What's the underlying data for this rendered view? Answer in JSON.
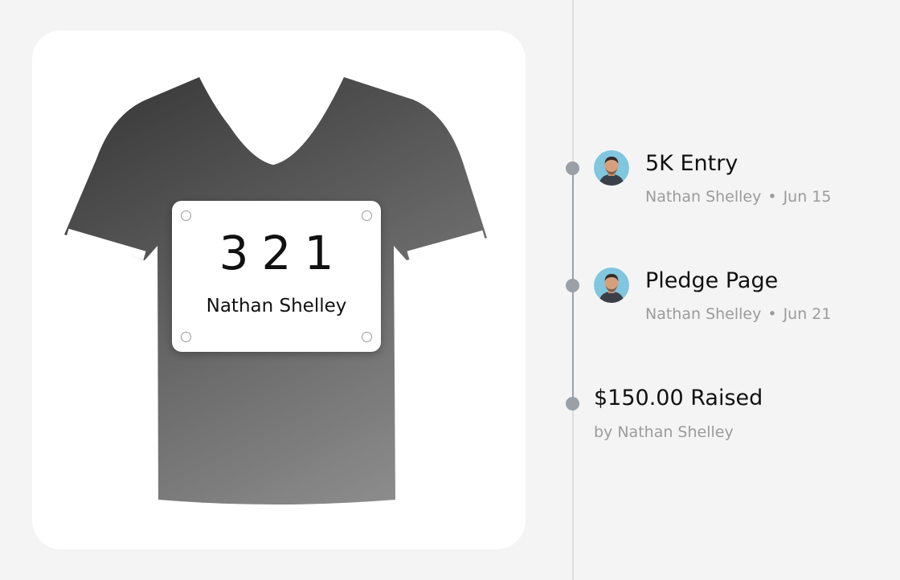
{
  "bib": {
    "number": "321",
    "name": "Nathan Shelley"
  },
  "timeline": {
    "events": [
      {
        "title": "5K Entry",
        "author": "Nathan Shelley",
        "separator": "•",
        "date": "Jun 15"
      },
      {
        "title": "Pledge Page",
        "author": "Nathan Shelley",
        "separator": "•",
        "date": "Jun 21"
      },
      {
        "title": "$150.00 Raised",
        "byline": "by Nathan Shelley"
      }
    ]
  },
  "colors": {
    "background": "#f4f4f4",
    "card": "#ffffff",
    "shirt_dark": "#3f3f3f",
    "shirt_light": "#8a8a8a",
    "timeline_dot": "#9aa0a8",
    "muted_text": "#9b9b9b"
  },
  "icons": [
    "t-shirt-icon",
    "race-bib",
    "avatar"
  ]
}
